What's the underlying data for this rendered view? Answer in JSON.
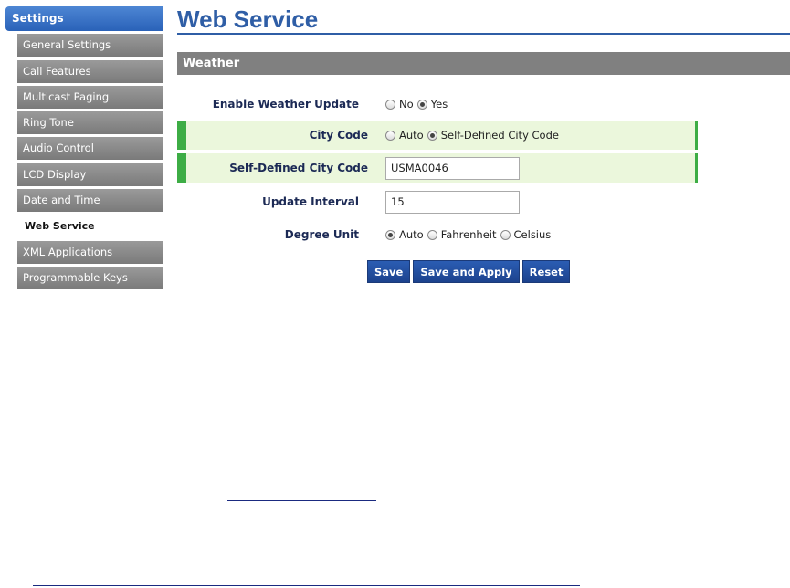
{
  "sidebar": {
    "header": "Settings",
    "items": [
      {
        "label": "General Settings",
        "active": false
      },
      {
        "label": "Call Features",
        "active": false
      },
      {
        "label": "Multicast Paging",
        "active": false
      },
      {
        "label": "Ring Tone",
        "active": false
      },
      {
        "label": "Audio Control",
        "active": false
      },
      {
        "label": "LCD Display",
        "active": false
      },
      {
        "label": "Date and Time",
        "active": false
      },
      {
        "label": "Web Service",
        "active": true
      },
      {
        "label": "XML Applications",
        "active": false
      },
      {
        "label": "Programmable Keys",
        "active": false
      }
    ]
  },
  "main": {
    "title": "Web Service",
    "section": "Weather",
    "enable_weather": {
      "label": "Enable Weather Update",
      "options": [
        "No",
        "Yes"
      ],
      "selected": "Yes"
    },
    "city_code": {
      "label": "City Code",
      "options": [
        "Auto",
        "Self-Defined City Code"
      ],
      "selected": "Self-Defined City Code"
    },
    "self_defined_city_code": {
      "label": "Self-Defined City Code",
      "value": "USMA0046"
    },
    "update_interval": {
      "label": "Update Interval",
      "value": "15"
    },
    "degree_unit": {
      "label": "Degree Unit",
      "options": [
        "Auto",
        "Fahrenheit",
        "Celsius"
      ],
      "selected": "Auto"
    },
    "buttons": {
      "save": "Save",
      "save_apply": "Save and Apply",
      "reset": "Reset"
    }
  },
  "colors": {
    "accent": "#2f5ea6",
    "highlight_border": "#3dad45",
    "highlight_bg": "#ebf7dc"
  }
}
